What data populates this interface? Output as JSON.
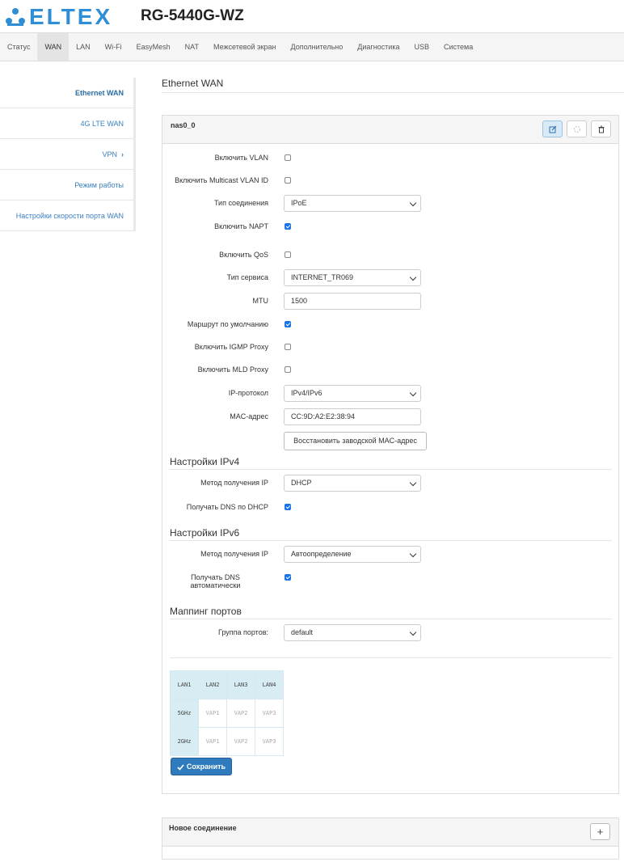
{
  "brand": {
    "logo_text": "ELTEX",
    "model": "RG-5440G-WZ",
    "accent": "#2f8fd6"
  },
  "topnav": [
    {
      "label": "Статус",
      "active": false
    },
    {
      "label": "WAN",
      "active": true
    },
    {
      "label": "LAN",
      "active": false
    },
    {
      "label": "Wi-Fi",
      "active": false
    },
    {
      "label": "EasyMesh",
      "active": false
    },
    {
      "label": "NAT",
      "active": false
    },
    {
      "label": "Межсетевой экран",
      "active": false
    },
    {
      "label": "Дополнительно",
      "active": false
    },
    {
      "label": "Диагностика",
      "active": false
    },
    {
      "label": "USB",
      "active": false
    },
    {
      "label": "Система",
      "active": false
    }
  ],
  "sidebar": [
    {
      "label": "Ethernet WAN",
      "active": true
    },
    {
      "label": "4G LTE WAN",
      "active": false
    },
    {
      "label": "VPN",
      "active": false,
      "chevron": "›"
    },
    {
      "label": "Режим работы",
      "active": false
    },
    {
      "label": "Настройки скорости порта WAN",
      "active": false
    }
  ],
  "page_title": "Ethernet WAN",
  "connection": {
    "name": "nas0_0",
    "fields": {
      "vlan": {
        "label": "Включить VLAN",
        "checked": false
      },
      "mcast_vlan": {
        "label": "Включить Multicast VLAN ID",
        "checked": false
      },
      "conn_type": {
        "label": "Тип соединения",
        "value": "IPoE"
      },
      "napt": {
        "label": "Включить NAPT",
        "checked": true
      },
      "qos": {
        "label": "Включить QoS",
        "checked": false
      },
      "service": {
        "label": "Тип сервиса",
        "value": "INTERNET_TR069"
      },
      "mtu": {
        "label": "MTU",
        "value": "1500"
      },
      "default_route": {
        "label": "Маршрут по умолчанию",
        "checked": true
      },
      "igmp": {
        "label": "Включить IGMP Proxy",
        "checked": false
      },
      "mld": {
        "label": "Включить MLD Proxy",
        "checked": false
      },
      "ip_proto": {
        "label": "IP-протокол",
        "value": "IPv4/IPv6"
      },
      "mac": {
        "label": "MAC-адрес",
        "value": "CC:9D:A2:E2:38:94"
      },
      "restore_mac": "Восстановить заводской MAC-адрес"
    },
    "ipv4": {
      "title": "Настройки IPv4",
      "method": {
        "label": "Метод получения IP",
        "value": "DHCP"
      },
      "dns": {
        "label": "Получать DNS по DHCP",
        "checked": true
      }
    },
    "ipv6": {
      "title": "Настройки IPv6",
      "method": {
        "label": "Метод получения IP",
        "value": "Автоопределение"
      },
      "dns_line1": "Получать DNS",
      "dns_line2": "автоматически",
      "dns_checked": true
    },
    "mapping": {
      "title": "Маппинг портов",
      "group": {
        "label": "Группа портов:",
        "value": "default"
      },
      "grid": [
        [
          "LAN1",
          "LAN2",
          "LAN3",
          "LAN4"
        ],
        [
          "5GHz",
          "VAP1",
          "VAP2",
          "VAP3"
        ],
        [
          "2GHz",
          "VAP1",
          "VAP2",
          "VAP3"
        ]
      ]
    },
    "save_label": "Сохранить"
  },
  "new_connection": {
    "title": "Новое соединение",
    "add_label": "+"
  }
}
